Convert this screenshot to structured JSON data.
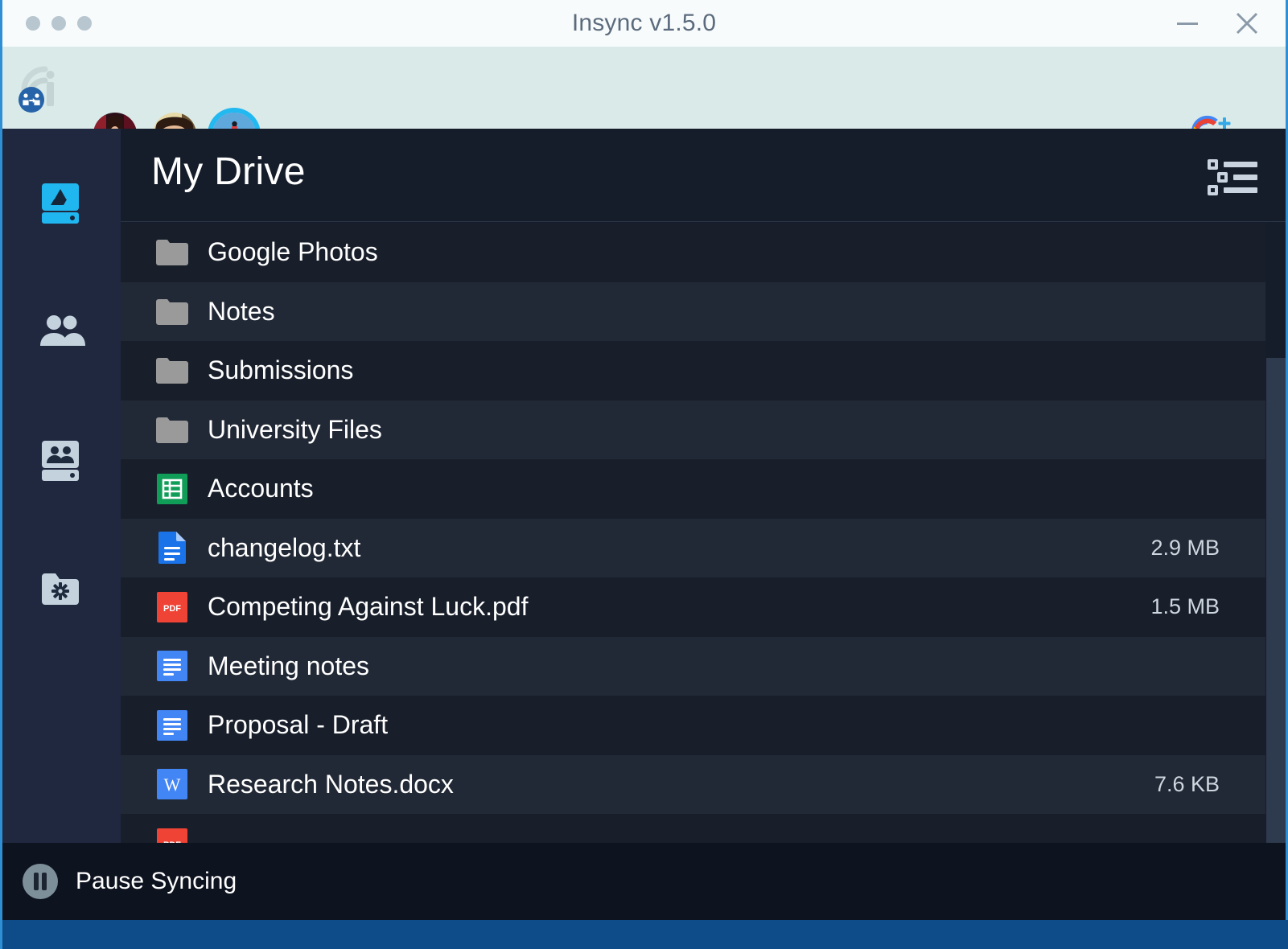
{
  "window": {
    "title": "Insync v1.5.0",
    "minimize_label": "Minimize",
    "close_label": "Close",
    "accent_color": "#2e8fd4",
    "titlebar_bg": "#f8fbfc"
  },
  "account_bar": {
    "logo_name": "insync-logo",
    "bg_color": "#d9eae9",
    "accounts": [
      {
        "name": "account-avatar-1",
        "selected": false
      },
      {
        "name": "account-avatar-2",
        "selected": false
      },
      {
        "name": "account-avatar-3",
        "selected": true
      }
    ],
    "add_account_icon": "google-plus-icon",
    "add_account_label": "Add Google account"
  },
  "sidebar": {
    "bg_color": "#202840",
    "items": [
      {
        "label": "My Drive",
        "icon": "google-drive-icon",
        "active": true
      },
      {
        "label": "Shared with me",
        "icon": "people-icon",
        "active": false
      },
      {
        "label": "Team Drives",
        "icon": "team-drive-icon",
        "active": false
      },
      {
        "label": "Selective Sync",
        "icon": "folder-gear-icon",
        "active": false
      }
    ]
  },
  "main": {
    "title": "My Drive",
    "view_toggle_icon": "list-view-icon",
    "bg_color": "#161d2a",
    "rows": [
      {
        "name": "Google Photos",
        "icon": "folder-icon",
        "size": ""
      },
      {
        "name": "Notes",
        "icon": "folder-icon",
        "size": ""
      },
      {
        "name": "Submissions",
        "icon": "folder-icon",
        "size": ""
      },
      {
        "name": "University Files",
        "icon": "folder-icon",
        "size": ""
      },
      {
        "name": "Accounts",
        "icon": "google-sheets-icon",
        "size": ""
      },
      {
        "name": "changelog.txt",
        "icon": "text-file-icon",
        "size": "2.9 MB"
      },
      {
        "name": "Competing Against Luck.pdf",
        "icon": "pdf-icon",
        "size": "1.5 MB"
      },
      {
        "name": "Meeting notes",
        "icon": "google-docs-icon",
        "size": ""
      },
      {
        "name": "Proposal - Draft",
        "icon": "google-docs-icon",
        "size": ""
      },
      {
        "name": "Research Notes.docx",
        "icon": "word-doc-icon",
        "size": "7.6 KB"
      },
      {
        "name": "",
        "icon": "pdf-icon",
        "size": ""
      }
    ]
  },
  "status_bar": {
    "pause_label": "Pause Syncing",
    "pause_icon": "pause-circle-icon",
    "bg_color": "#0e1320"
  },
  "taskbar": {
    "color": "#0d4b89"
  }
}
